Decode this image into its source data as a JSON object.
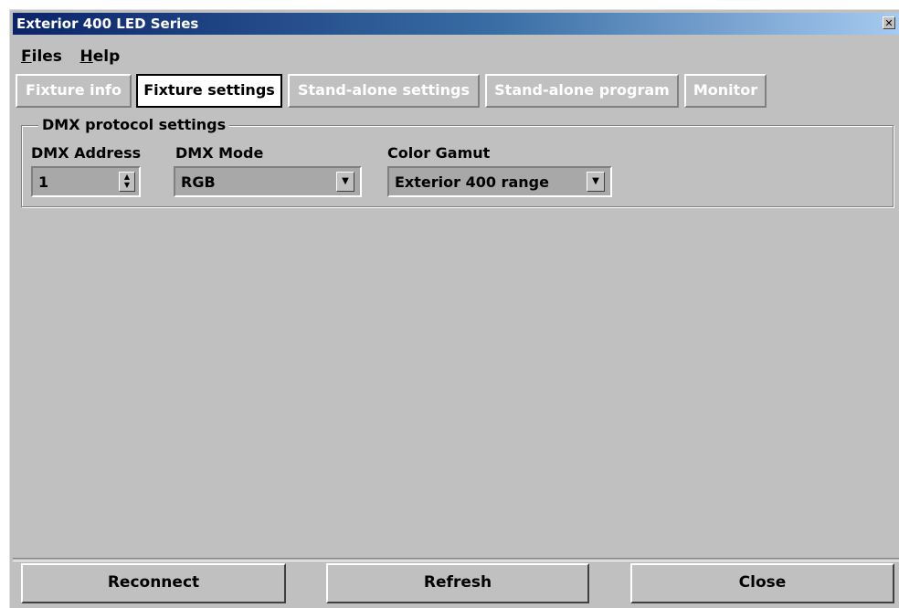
{
  "window": {
    "title": "Exterior 400 LED Series",
    "close_icon": "×"
  },
  "menu": {
    "files": {
      "hotkey": "F",
      "rest": "iles"
    },
    "help": {
      "hotkey": "H",
      "rest": "elp"
    }
  },
  "tabs": [
    {
      "label": "Fixture info",
      "enabled": false
    },
    {
      "label": "Fixture settings",
      "active": true
    },
    {
      "label": "Stand-alone settings",
      "enabled": false
    },
    {
      "label": "Stand-alone program",
      "enabled": false
    },
    {
      "label": "Monitor",
      "enabled": false
    }
  ],
  "dmx": {
    "group_title": "DMX protocol settings",
    "address_label": "DMX Address",
    "address_value": "1",
    "mode_label": "DMX Mode",
    "mode_value": "RGB",
    "gamut_label": "Color Gamut",
    "gamut_value": "Exterior 400 range"
  },
  "buttons": {
    "reconnect": "Reconnect",
    "refresh": "Refresh",
    "close": "Close"
  },
  "colors": {
    "face": "#c0c0c0",
    "title_start": "#0a246a",
    "title_end": "#a6caf0"
  }
}
